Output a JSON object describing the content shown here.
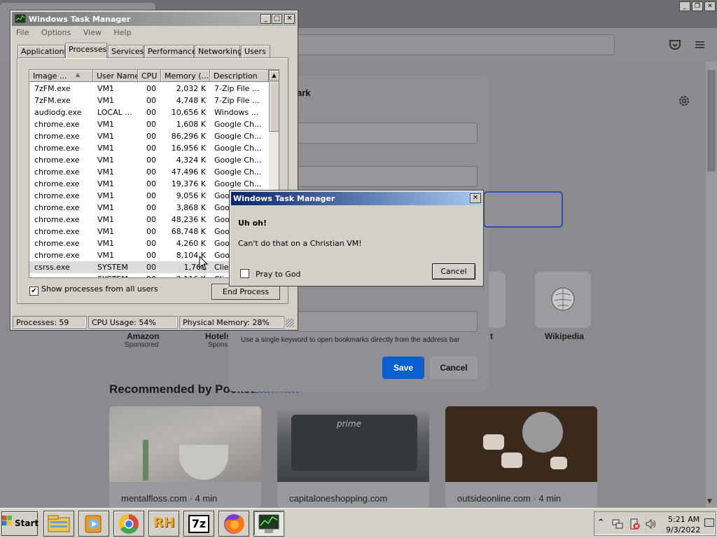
{
  "browser": {
    "window_controls": [
      "_",
      "❐",
      "✕"
    ],
    "tiles": [
      {
        "label": "Amazon",
        "sub": "Sponsored"
      },
      {
        "label": "Hotels",
        "sub": "Spons"
      },
      {
        "label": "t",
        "sub": ""
      },
      {
        "label": "Wikipedia",
        "sub": ""
      }
    ],
    "pocket_title": "Recommended by Pocket",
    "pocket_learn": "Learn more",
    "cards": [
      {
        "source": "mentalfloss.com · 4 min"
      },
      {
        "source": "capitaloneshopping.com"
      },
      {
        "source": "outsideonline.com · 4 min"
      }
    ]
  },
  "bookmark": {
    "title": "ark",
    "hint": "Use a single keyword to open bookmarks directly from the address bar",
    "save": "Save",
    "cancel": "Cancel"
  },
  "taskmgr": {
    "title": "Windows Task Manager",
    "controls": [
      "_",
      "□",
      "✕"
    ],
    "menu": [
      "File",
      "Options",
      "View",
      "Help"
    ],
    "tabs": [
      "Applications",
      "Processes",
      "Services",
      "Performance",
      "Networking",
      "Users"
    ],
    "active_tab": "Processes",
    "columns": [
      "Image ...",
      "User Name",
      "CPU",
      "Memory (...",
      "Description"
    ],
    "rows": [
      [
        "7zFM.exe",
        "VM1",
        "00",
        "2,032 K",
        "7-Zip File ..."
      ],
      [
        "7zFM.exe",
        "VM1",
        "00",
        "4,748 K",
        "7-Zip File ..."
      ],
      [
        "audiodg.exe",
        "LOCAL ...",
        "00",
        "10,656 K",
        "Windows ..."
      ],
      [
        "chrome.exe",
        "VM1",
        "00",
        "1,608 K",
        "Google Ch..."
      ],
      [
        "chrome.exe",
        "VM1",
        "00",
        "86,296 K",
        "Google Ch..."
      ],
      [
        "chrome.exe",
        "VM1",
        "00",
        "16,956 K",
        "Google Ch..."
      ],
      [
        "chrome.exe",
        "VM1",
        "00",
        "4,324 K",
        "Google Ch..."
      ],
      [
        "chrome.exe",
        "VM1",
        "00",
        "47,496 K",
        "Google Ch..."
      ],
      [
        "chrome.exe",
        "VM1",
        "00",
        "19,376 K",
        "Google Ch..."
      ],
      [
        "chrome.exe",
        "VM1",
        "00",
        "9,056 K",
        "Goo"
      ],
      [
        "chrome.exe",
        "VM1",
        "00",
        "3,868 K",
        "Goo"
      ],
      [
        "chrome.exe",
        "VM1",
        "00",
        "48,236 K",
        "Goo"
      ],
      [
        "chrome.exe",
        "VM1",
        "00",
        "68,748 K",
        "Goo"
      ],
      [
        "chrome.exe",
        "VM1",
        "00",
        "4,260 K",
        "Goo"
      ],
      [
        "chrome.exe",
        "VM1",
        "00",
        "8,104 K",
        "Goo"
      ],
      [
        "csrss.exe",
        "SYSTEM",
        "00",
        "1,768",
        "Clier"
      ],
      [
        "csrss.exe",
        "SYSTEM",
        "00",
        "2,116 K",
        "Clier"
      ]
    ],
    "show_all_label": "Show processes from all users",
    "show_all_checked": "✔",
    "end_process": "End Process",
    "status": {
      "processes": "Processes: 59",
      "cpu": "CPU Usage: 54%",
      "memory": "Physical Memory: 28%"
    }
  },
  "error_dialog": {
    "title": "Windows Task Manager",
    "close": "✕",
    "heading": "Uh oh!",
    "message": "Can't do that on a Christian VM!",
    "checkbox_label": "Pray to God",
    "cancel": "Cancel"
  },
  "taskbar": {
    "start": "Start",
    "apps": [
      "file-explorer-icon",
      "media-player-icon",
      "chrome-icon",
      "rh-icon",
      "7zip-icon",
      "firefox-icon",
      "task-manager-icon"
    ],
    "rh_label": "RH",
    "sevenzip_label": "7z",
    "time": "5:21 AM",
    "date": "9/3/2022"
  }
}
